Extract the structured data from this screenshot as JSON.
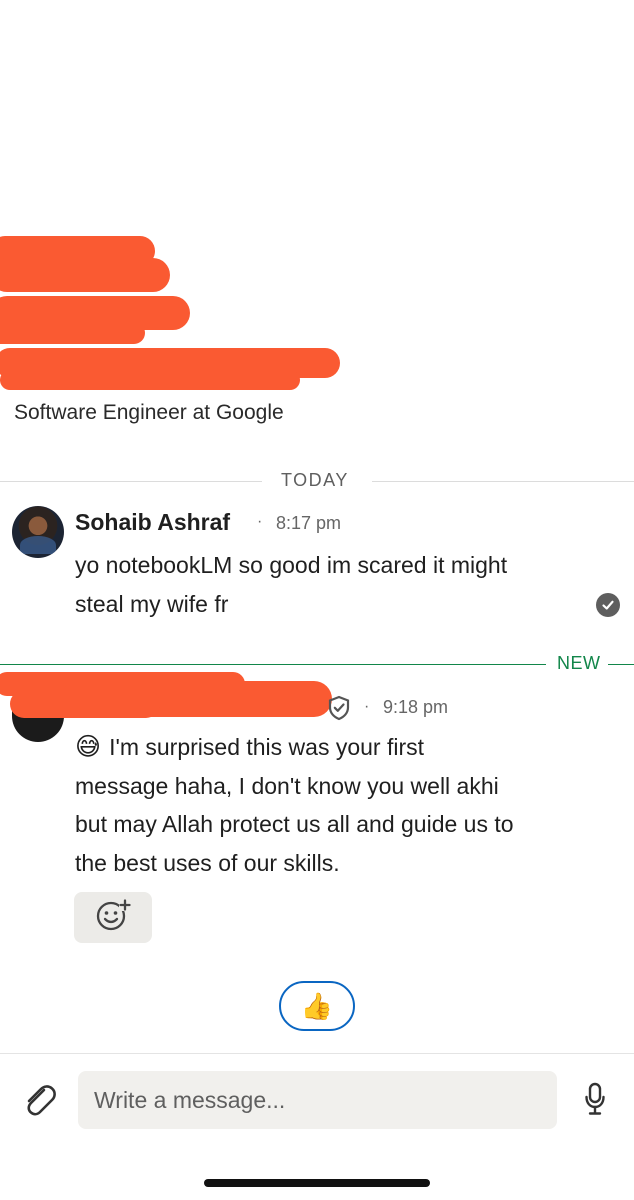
{
  "profile": {
    "headline": "Software Engineer at Google"
  },
  "dividers": {
    "today": "TODAY",
    "new": "NEW"
  },
  "messages": [
    {
      "sender": "Sohaib Ashraf",
      "time": "8:17 pm",
      "dot": "·",
      "lines": [
        "yo notebookLM so good im scared it might",
        "steal my wife fr"
      ]
    },
    {
      "time": "9:18 pm",
      "dot": "·",
      "emoji": "😅",
      "lines": [
        "I'm surprised this was your first",
        "message haha, I don't know you well akhi",
        "but may Allah protect us all and guide us to",
        "the best uses of our skills."
      ]
    }
  ],
  "quick_reaction": "👍",
  "composer": {
    "placeholder": "Write a message..."
  },
  "icons": {
    "read_receipt": "check-circle-icon",
    "verified": "shield-check-icon",
    "add_reaction": "add-reaction-icon",
    "attach": "paperclip-icon",
    "mic": "microphone-icon"
  },
  "colors": {
    "redaction": "#fa5a32",
    "new_divider": "#12864a",
    "link_blue": "#0a66c2"
  }
}
